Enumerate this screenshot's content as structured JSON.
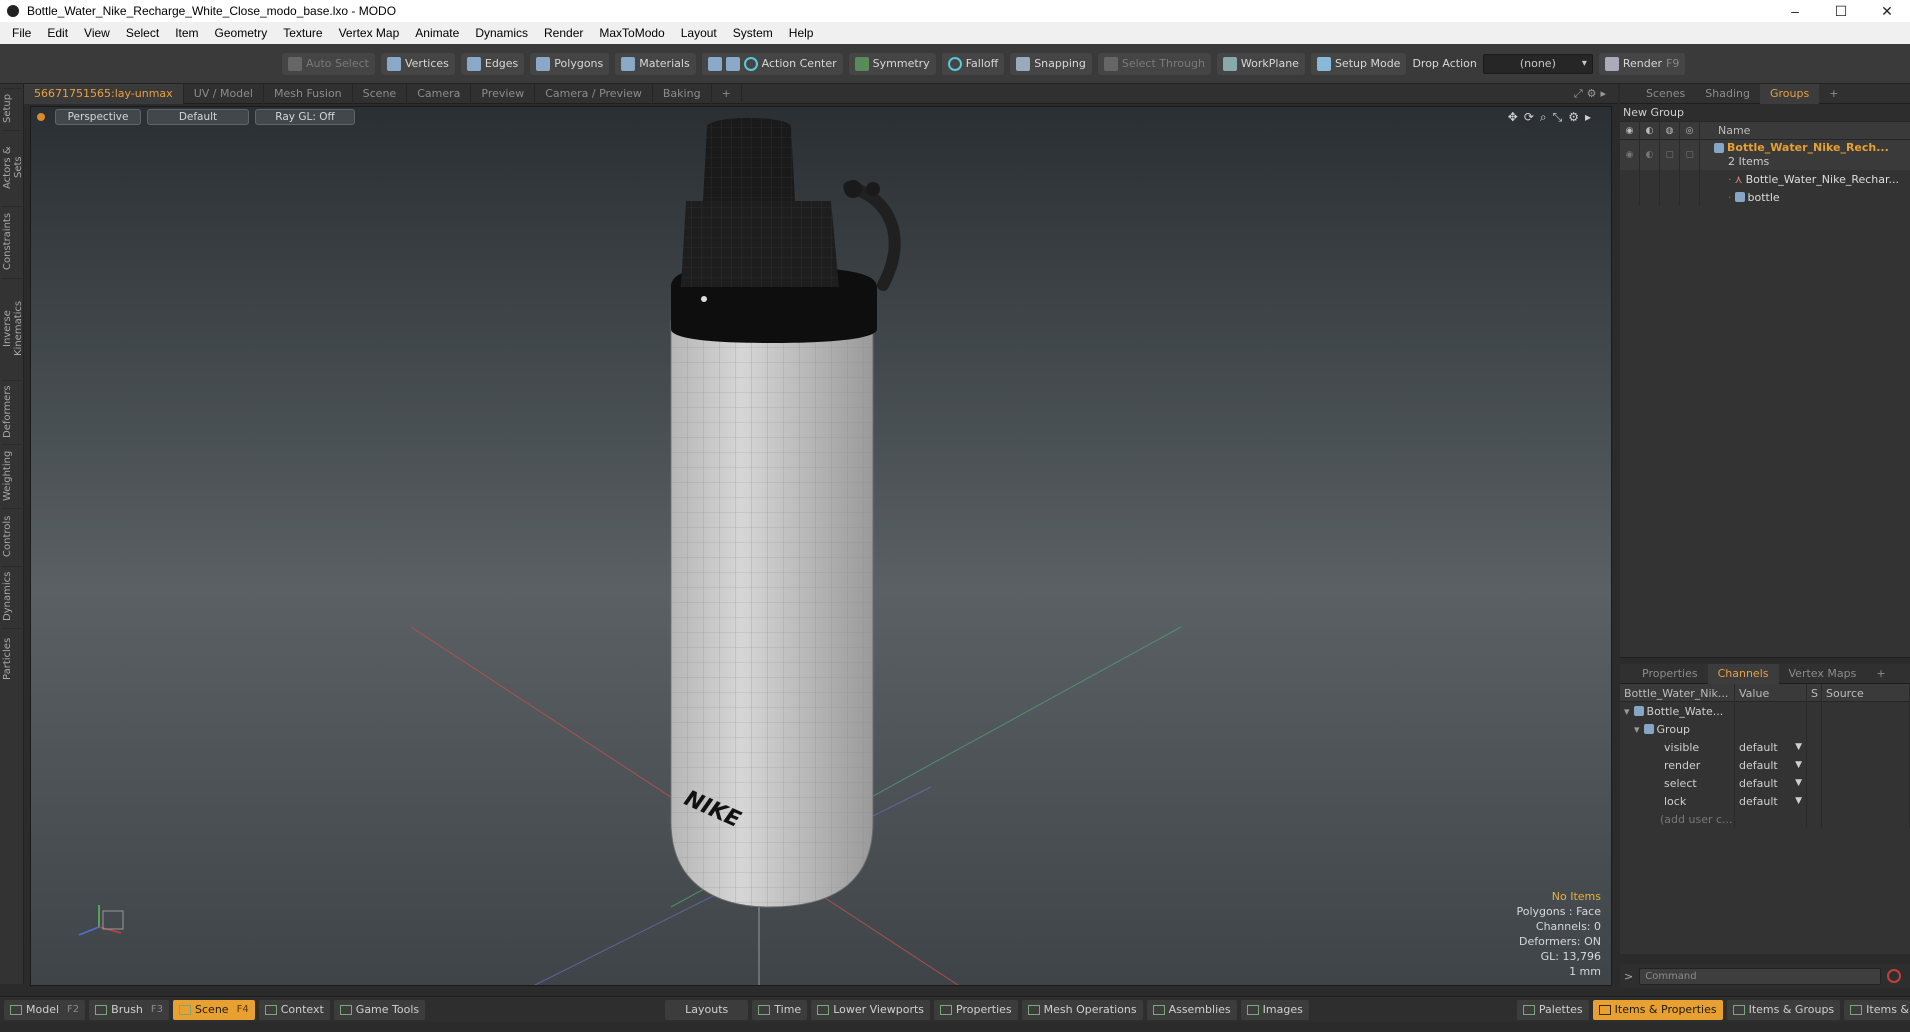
{
  "window": {
    "title": "Bottle_Water_Nike_Recharge_White_Close_modo_base.lxo - MODO"
  },
  "menu": [
    "File",
    "Edit",
    "View",
    "Select",
    "Item",
    "Geometry",
    "Texture",
    "Vertex Map",
    "Animate",
    "Dynamics",
    "Render",
    "MaxToModo",
    "Layout",
    "System",
    "Help"
  ],
  "toolbar": {
    "auto_select": "Auto Select",
    "vertices": "Vertices",
    "edges": "Edges",
    "polygons": "Polygons",
    "materials": "Materials",
    "action_center": "Action Center",
    "symmetry": "Symmetry",
    "falloff": "Falloff",
    "snapping": "Snapping",
    "select_through": "Select Through",
    "workplane": "WorkPlane",
    "setup_mode": "Setup Mode",
    "drop_action": "Drop Action",
    "drop_value": "(none)",
    "render": "Render",
    "render_key": "F9"
  },
  "left_tabs": [
    "Setup",
    "Actors & Sets",
    "Constraints",
    "Inverse Kinematics",
    "Deformers",
    "Weighting",
    "Controls",
    "Dynamics",
    "Particles"
  ],
  "viewport_tabs": [
    "56671751565:lay-unmax",
    "UV / Model",
    "Mesh Fusion",
    "Scene",
    "Camera",
    "Preview",
    "Camera / Preview",
    "Baking",
    "+"
  ],
  "viewport": {
    "view": "Perspective",
    "style": "Default",
    "raygl": "Ray GL: Off",
    "brand_text": "NIKE",
    "info": {
      "items": "No Items",
      "polygons": "Polygons : Face",
      "channels": "Channels: 0",
      "deformers": "Deformers: ON",
      "gl": "GL: 13,796",
      "unit": "1 mm"
    }
  },
  "right_tabs": [
    "Scenes",
    "Shading",
    "Groups",
    "+"
  ],
  "groups": {
    "new_group": "New Group",
    "name_header": "Name",
    "group_name": "Bottle_Water_Nike_Rech...",
    "group_count": "2 Items",
    "children": [
      "Bottle_Water_Nike_Rechar...",
      "bottle"
    ]
  },
  "props_tabs": [
    "Properties",
    "Channels",
    "Vertex Maps",
    "+"
  ],
  "channels": {
    "headers": [
      "Bottle_Water_Nik...",
      "Value",
      "S",
      "Source"
    ],
    "root": "Bottle_Wate...",
    "group": "Group",
    "rows": [
      {
        "name": "visible",
        "value": "default"
      },
      {
        "name": "render",
        "value": "default"
      },
      {
        "name": "select",
        "value": "default"
      },
      {
        "name": "lock",
        "value": "default"
      }
    ],
    "add_user": "(add user c..."
  },
  "command": {
    "placeholder": "Command",
    "prompt": ">"
  },
  "bottom": {
    "left": [
      {
        "label": "Model",
        "key": "F2"
      },
      {
        "label": "Brush",
        "key": "F3"
      },
      {
        "label": "Scene",
        "key": "F4"
      },
      {
        "label": "Context",
        "key": ""
      },
      {
        "label": "Game Tools",
        "key": ""
      }
    ],
    "center": [
      "Layouts",
      "Time",
      "Lower Viewports",
      "Properties",
      "Mesh Operations",
      "Assemblies",
      "Images"
    ],
    "right": [
      "Palettes",
      "Items & Properties",
      "Items & Groups",
      "Items & Shading"
    ]
  },
  "colors": {
    "accent": "#e8a030",
    "bg": "#2b2b2b"
  }
}
